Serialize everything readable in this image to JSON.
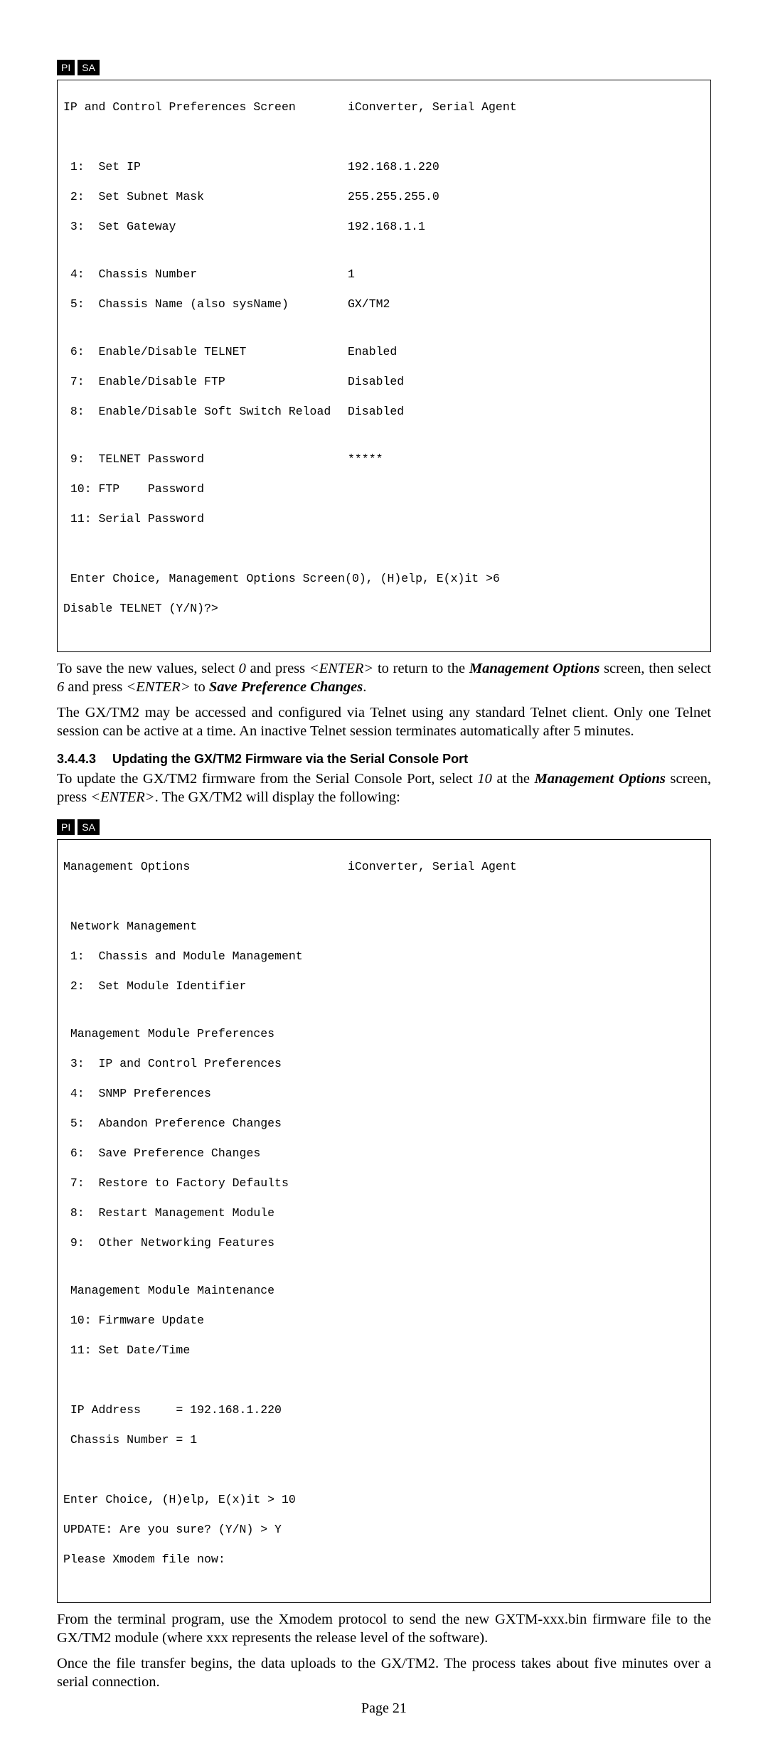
{
  "tags": {
    "pi": "PI",
    "sa": "SA"
  },
  "terminal1": {
    "title_left": "IP and Control Preferences Screen",
    "title_right": "iConverter, Serial Agent",
    "r1_l": " 1:  Set IP",
    "r1_r": "192.168.1.220",
    "r2_l": " 2:  Set Subnet Mask",
    "r2_r": "255.255.255.0",
    "r3_l": " 3:  Set Gateway",
    "r3_r": "192.168.1.1",
    "r4_l": " 4:  Chassis Number",
    "r4_r": "1",
    "r5_l": " 5:  Chassis Name (also sysName)",
    "r5_r": "GX/TM2",
    "r6_l": " 6:  Enable/Disable TELNET",
    "r6_r": "Enabled",
    "r7_l": " 7:  Enable/Disable FTP",
    "r7_r": "Disabled",
    "r8_l": " 8:  Enable/Disable Soft Switch Reload",
    "r8_r": "Disabled",
    "r9_l": " 9:  TELNET Password",
    "r9_r": "*****",
    "r10": " 10: FTP    Password",
    "r11": " 11: Serial Password",
    "footer1": " Enter Choice, Management Options Screen(0), (H)elp, E(x)it >6",
    "footer2": "Disable TELNET (Y/N)?>"
  },
  "para1": {
    "t1": "To save the new values, select ",
    "i1": "0",
    "t2": " and press ",
    "i2": "<ENTER>",
    "t3": " to return to the ",
    "bi1": "Management Options",
    "t4": " screen, then select ",
    "i3": "6",
    "t5": " and press ",
    "i4": "<ENTER>",
    "t6": " to ",
    "bi2": "Save Preference Changes",
    "t7": "."
  },
  "para2": "The GX/TM2 may be accessed and configured via Telnet using any standard Telnet client.  Only one Telnet session can be active at a time.  An inactive Telnet session terminates automatically after 5 minutes.",
  "heading": {
    "num": "3.4.4.3",
    "text": "Updating the GX/TM2 Firmware via the Serial Console Port"
  },
  "para3": {
    "t1": "To update the GX/TM2 firmware from the Serial Console Port, select ",
    "i1": "10",
    "t2": " at the ",
    "bi1": "Management Options",
    "t3": " screen, press ",
    "i2": "<ENTER>",
    "t4": ".  The GX/TM2 will display the following:"
  },
  "terminal2": {
    "title_left": "Management Options",
    "title_right": "iConverter, Serial Agent",
    "l1": " Network Management",
    "l2": " 1:  Chassis and Module Management",
    "l3": " 2:  Set Module Identifier",
    "l4": " Management Module Preferences",
    "l5": " 3:  IP and Control Preferences",
    "l6": " 4:  SNMP Preferences",
    "l7": " 5:  Abandon Preference Changes",
    "l8": " 6:  Save Preference Changes",
    "l9": " 7:  Restore to Factory Defaults",
    "l10": " 8:  Restart Management Module",
    "l11": " 9:  Other Networking Features",
    "l12": " Management Module Maintenance",
    "l13": " 10: Firmware Update",
    "l14": " 11: Set Date/Time",
    "l15": " IP Address     = 192.168.1.220",
    "l16": " Chassis Number = 1",
    "f1": "Enter Choice, (H)elp, E(x)it > 10",
    "f2": "UPDATE: Are you sure? (Y/N) > Y",
    "f3": "Please Xmodem file now:"
  },
  "para4": "From the terminal program, use the Xmodem protocol to send the new GXTM-xxx.bin firmware file to the GX/TM2 module (where xxx represents the release level of the software).",
  "para5": "Once the file transfer begins, the data uploads to the GX/TM2.  The process takes about five minutes over a serial connection.",
  "page_number": "Page 21"
}
